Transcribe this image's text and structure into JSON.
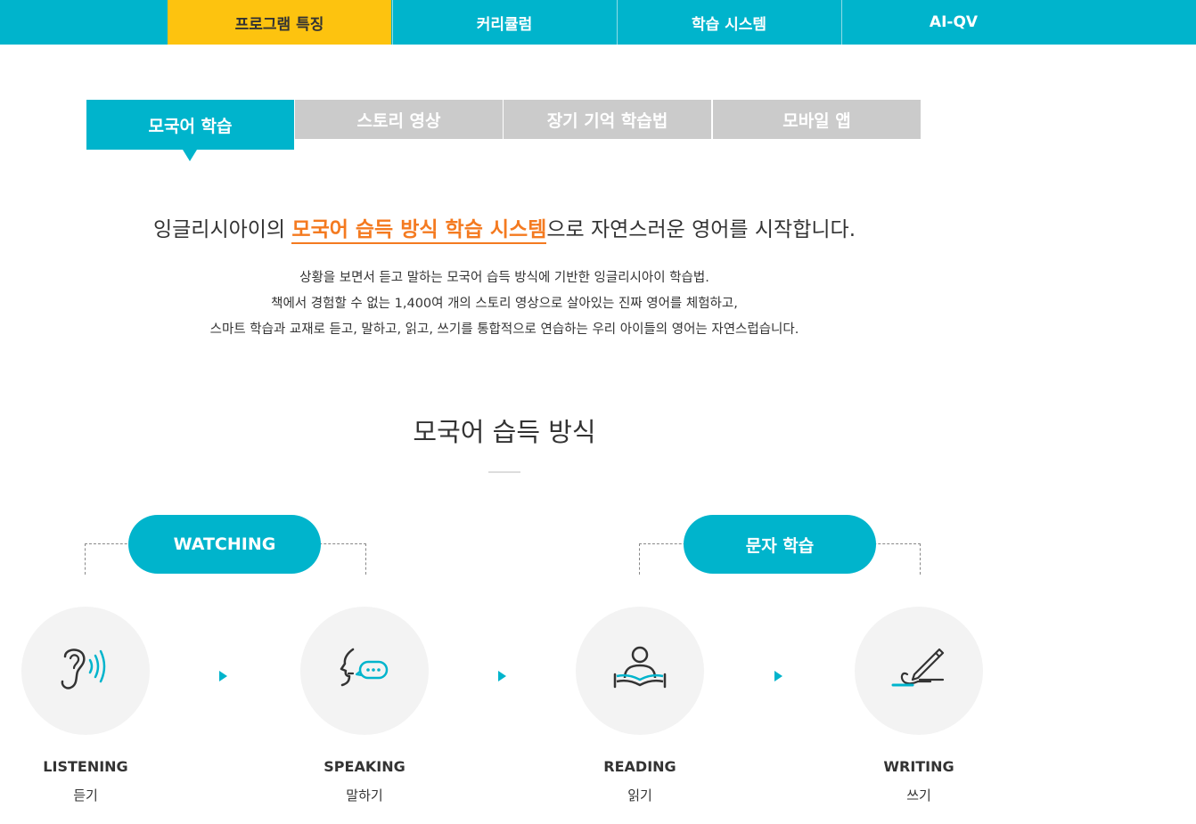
{
  "top_nav": {
    "tabs": [
      {
        "label": "프로그램 특징"
      },
      {
        "label": "커리큘럼"
      },
      {
        "label": "학습 시스템"
      },
      {
        "label": "AI-QV"
      }
    ]
  },
  "sub_tabs": [
    {
      "label": "모국어 학습"
    },
    {
      "label": "스토리 영상"
    },
    {
      "label": "장기 기억 학습법"
    },
    {
      "label": "모바일 앱"
    }
  ],
  "headline": {
    "prefix": "잉글리시아이의 ",
    "highlight": "모국어 습득 방식 학습 시스템",
    "suffix": "으로 자연스러운 영어를 시작합니다."
  },
  "description": {
    "line1": "상황을 보면서 듣고 말하는 모국어 습득 방식에 기반한 잉글리시아이 학습법.",
    "line2": "책에서 경험할 수 없는 1,400여 개의 스토리 영상으로 살아있는 진짜 영어를 체험하고,",
    "line3": "스마트 학습과 교재로 듣고, 말하고, 읽고, 쓰기를 통합적으로 연습하는 우리 아이들의 영어는 자연스럽습니다."
  },
  "section": {
    "title": "모국어 습득 방식",
    "groups": [
      {
        "label": "WATCHING"
      },
      {
        "label": "문자 학습"
      }
    ],
    "skills": [
      {
        "en": "LISTENING",
        "ko": "듣기",
        "icon": "ear-icon"
      },
      {
        "en": "SPEAKING",
        "ko": "말하기",
        "icon": "speaking-icon"
      },
      {
        "en": "READING",
        "ko": "읽기",
        "icon": "reading-icon"
      },
      {
        "en": "WRITING",
        "ko": "쓰기",
        "icon": "writing-icon"
      }
    ]
  },
  "colors": {
    "primary": "#00b4cc",
    "active_tab": "#fdc30f",
    "highlight": "#f47a20",
    "inactive_tab": "#cbcbcb"
  }
}
